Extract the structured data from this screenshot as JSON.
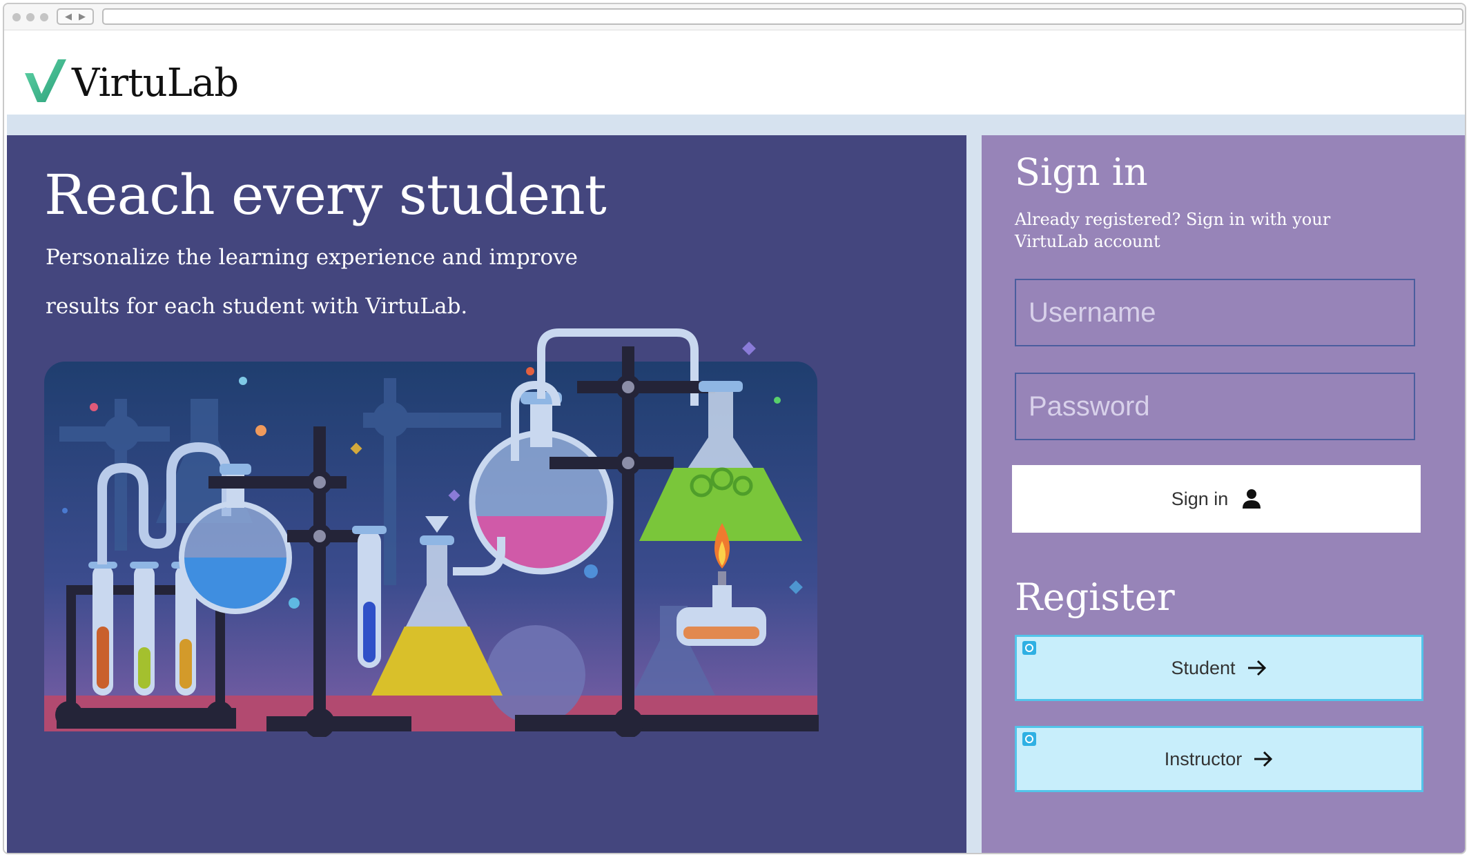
{
  "header": {
    "logo_text": "VirtuLab"
  },
  "hero": {
    "title": "Reach every student",
    "subtitle": "Personalize the learning experience and improve results for each student with VirtuLab."
  },
  "signin": {
    "title": "Sign in",
    "description": "Already registered? Sign in with your VirtuLab account",
    "username_placeholder": "Username",
    "password_placeholder": "Password",
    "button_label": "Sign in"
  },
  "register": {
    "title": "Register",
    "student_label": "Student",
    "instructor_label": "Instructor"
  },
  "colors": {
    "hero_bg": "#44467e",
    "panel_bg": "#9784b8",
    "register_btn_bg": "#c8eefb",
    "register_btn_border": "#53c4ea",
    "logo_green": "#3cb88a"
  },
  "icons": {
    "signin_button": "person-icon",
    "register_buttons": "arrow-right-icon",
    "logo": "checkmark-logo-icon"
  }
}
